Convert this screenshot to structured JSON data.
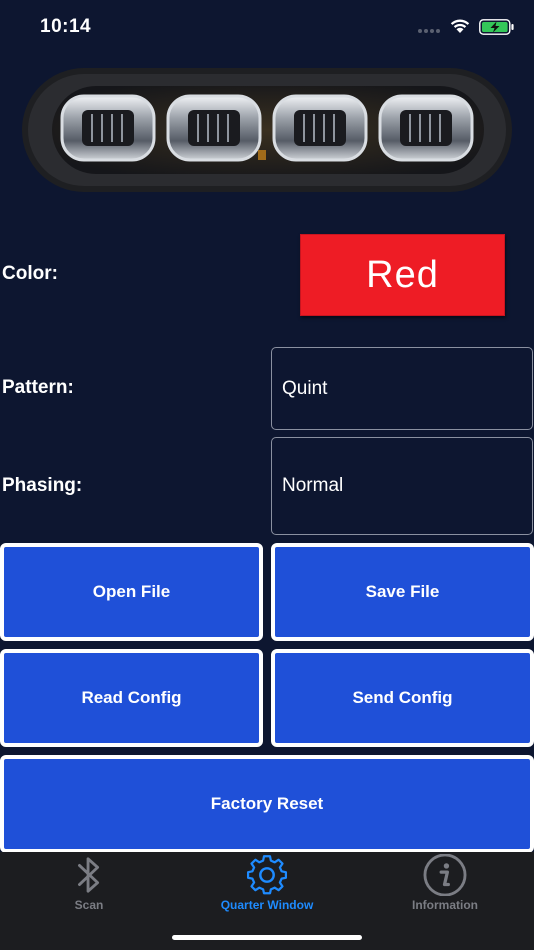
{
  "status_bar": {
    "time": "10:14"
  },
  "settings": {
    "color_label": "Color:",
    "color_value": "Red",
    "pattern_label": "Pattern:",
    "pattern_value": "Quint",
    "phasing_label": "Phasing:",
    "phasing_value": "Normal"
  },
  "buttons": {
    "open_file": "Open File",
    "save_file": "Save File",
    "read_config": "Read Config",
    "send_config": "Send Config",
    "factory_reset": "Factory Reset"
  },
  "tab_bar": {
    "tabs": [
      {
        "label": "Scan",
        "icon": "bluetooth-icon",
        "active": false
      },
      {
        "label": "Quarter Window",
        "icon": "gear-icon",
        "active": true
      },
      {
        "label": "Information",
        "icon": "info-icon",
        "active": false
      }
    ]
  },
  "colors": {
    "background": "#0d1630",
    "button": "#1f50d8",
    "swatch_red": "#ee1c25",
    "tab_active": "#1e8bff",
    "tab_inactive": "#7b7d84"
  }
}
